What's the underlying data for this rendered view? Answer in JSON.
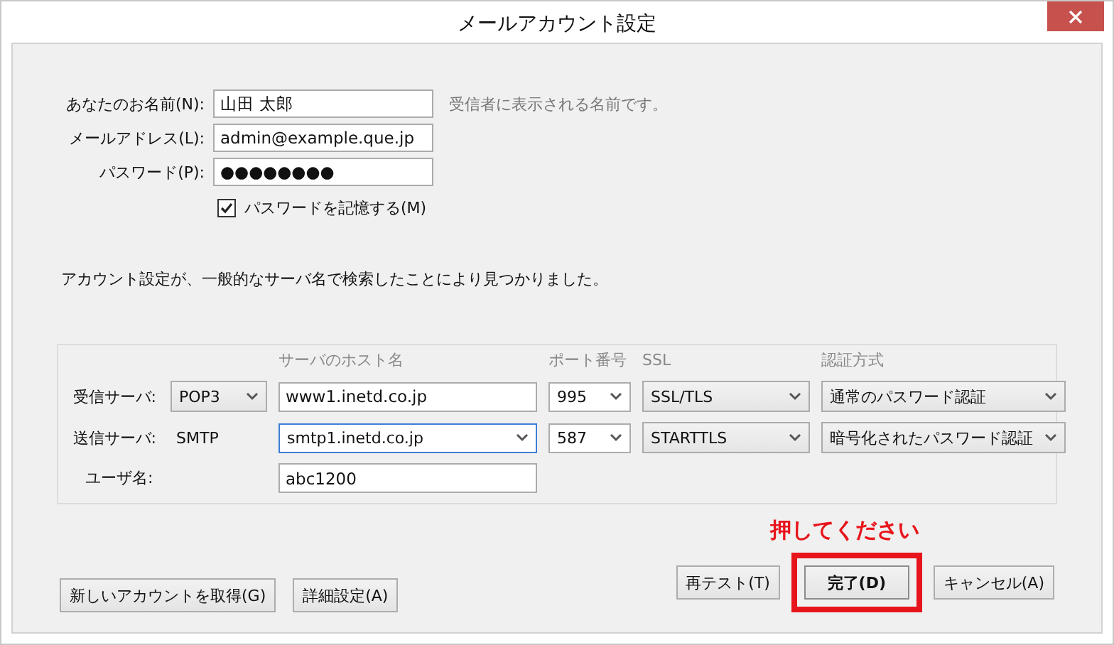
{
  "window": {
    "title": "メールアカウント設定"
  },
  "identity_fields": [
    {
      "label": "あなたのお名前(N):",
      "value": "山田 太郎",
      "hint": "受信者に表示される名前です。"
    },
    {
      "label": "メールアドレス(L):",
      "value": "admin@example.que.jp"
    },
    {
      "label": "パスワード(P):",
      "value": "●●●●●●●●"
    }
  ],
  "remember_password": {
    "label": "パスワードを記憶する(M)",
    "checked": true
  },
  "message": "アカウント設定が、一般的なサーバ名で検索したことにより見つかりました。",
  "server_table": {
    "columns": [
      "サーバのホスト名",
      "ポート番号",
      "SSL",
      "認証方式"
    ],
    "rows": [
      {
        "label": "受信サーバ:",
        "protocol": {
          "kind": "select",
          "value": "POP3"
        },
        "host": {
          "kind": "field",
          "value": "www1.inetd.co.jp",
          "focused": false
        },
        "port": "995",
        "ssl": "SSL/TLS",
        "auth": "通常のパスワード認証"
      },
      {
        "label": "送信サーバ:",
        "protocol": {
          "kind": "text",
          "value": "SMTP"
        },
        "host": {
          "kind": "combo",
          "value": "smtp1.inetd.co.jp",
          "focused": true
        },
        "port": "587",
        "ssl": "STARTTLS",
        "auth": "暗号化されたパスワード認証"
      }
    ],
    "username": {
      "label": "ユーザ名:",
      "value": "abc1200"
    }
  },
  "annotation": "押してください",
  "buttons_left": [
    "新しいアカウントを取得(G)",
    "詳細設定(A)"
  ],
  "buttons_right": [
    {
      "label": "再テスト(T)",
      "default": false,
      "highlighted": false
    },
    {
      "label": "完了(D)",
      "default": true,
      "highlighted": true
    },
    {
      "label": "キャンセル(A)",
      "default": false,
      "highlighted": false
    }
  ]
}
